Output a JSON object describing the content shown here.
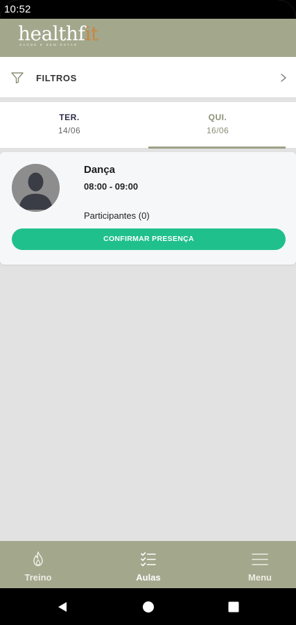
{
  "status_bar": {
    "time": "10:52"
  },
  "header": {
    "logo_text_main": "healthfit",
    "logo_text_start": "health",
    "logo_text_mid": "f",
    "logo_text_accent": "it",
    "logo_tagline": "SAÚDE E BEM-ESTAR"
  },
  "filters": {
    "label": "FILTROS",
    "icon": "filter-icon"
  },
  "day_tabs": [
    {
      "day": "TER.",
      "date": "14/06",
      "selected": false
    },
    {
      "day": "QUI.",
      "date": "16/06",
      "selected": true
    }
  ],
  "class_card": {
    "name": "Dança",
    "time": "08:00 - 09:00",
    "participants": "Participantes (0)",
    "confirm_label": "CONFIRMAR PRESENÇA"
  },
  "bottom_nav": [
    {
      "label": "Treino",
      "icon": "flame-icon"
    },
    {
      "label": "Aulas",
      "icon": "checklist-icon",
      "active": true
    },
    {
      "label": "Menu",
      "icon": "hamburger-icon"
    }
  ],
  "colors": {
    "brand": "#a3a78c",
    "accent": "#20c08d",
    "logo_accent": "#c98740",
    "tab_underline": "#9c9f85"
  }
}
